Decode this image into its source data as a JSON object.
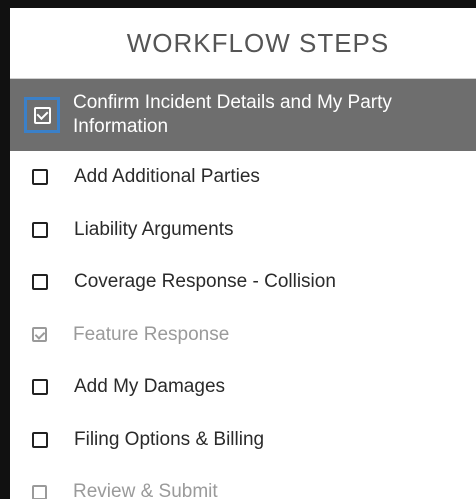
{
  "header": {
    "title": "WORKFLOW STEPS"
  },
  "steps": [
    {
      "label": "Confirm Incident Details and My Party Information",
      "state": "active",
      "checked": true
    },
    {
      "label": "Add Additional Parties",
      "state": "normal",
      "checked": false
    },
    {
      "label": "Liability Arguments",
      "state": "normal",
      "checked": false
    },
    {
      "label": "Coverage Response - Collision",
      "state": "normal",
      "checked": false
    },
    {
      "label": "Feature Response",
      "state": "disabled",
      "checked": true
    },
    {
      "label": "Add My Damages",
      "state": "normal",
      "checked": false
    },
    {
      "label": "Filing Options & Billing",
      "state": "normal",
      "checked": false
    },
    {
      "label": "Review & Submit",
      "state": "disabled",
      "checked": false
    }
  ],
  "colors": {
    "active_bg": "#6e6e6e",
    "focus_ring": "#3b80c8",
    "disabled_text": "#9a9a9a",
    "frame": "#111111"
  },
  "icons": {
    "checked": "checkbox-checked-icon",
    "unchecked": "checkbox-empty-icon"
  }
}
